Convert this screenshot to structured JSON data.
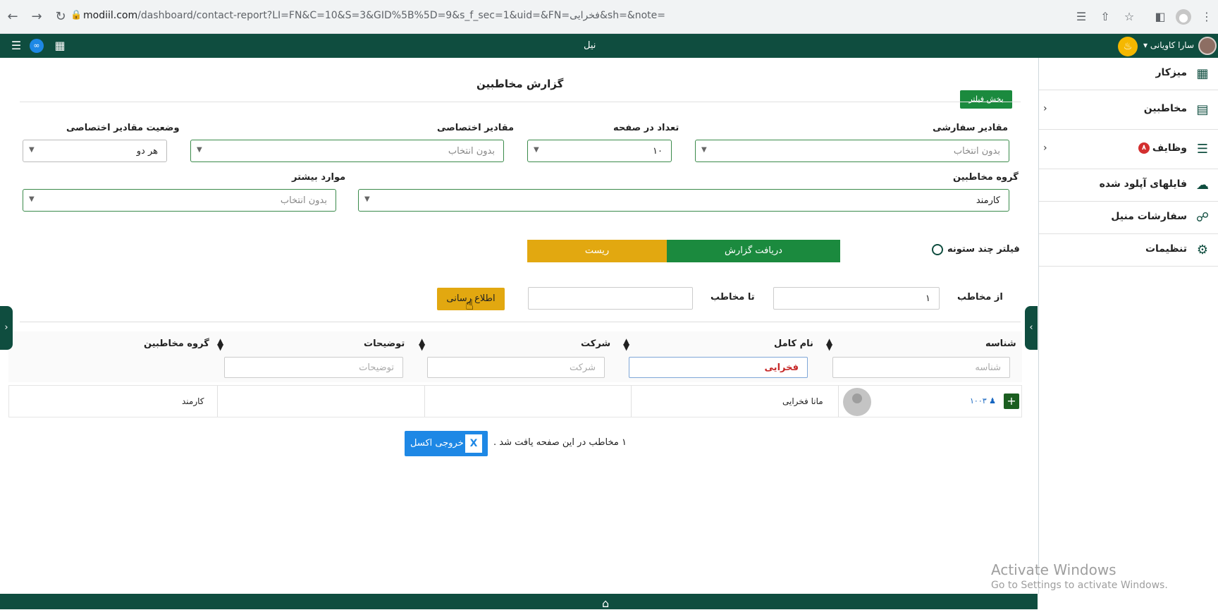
{
  "browser": {
    "url_domain": "modiil.com",
    "url_path": "/dashboard/contact-report?LI=FN&C=10&S=3&GID%5B%5D=9&s_f_sec=1&uid=&FN=فخرایی&sh=&note="
  },
  "appbar": {
    "center_text": "نیل",
    "user_name": "سارا کاویانی"
  },
  "sidebar": {
    "items": [
      {
        "label": "میزکار",
        "icon": "dashboard-icon"
      },
      {
        "label": "مخاطبین",
        "icon": "contacts-icon"
      },
      {
        "label": "وظایف",
        "badge": "۸",
        "icon": "tasks-icon"
      },
      {
        "label": "فایلهای آپلود شده",
        "icon": "cloud-upload-icon"
      },
      {
        "label": "سفارشات منیل",
        "icon": "cart-icon"
      },
      {
        "label": "تنظیمات",
        "icon": "gear-icon"
      }
    ]
  },
  "page": {
    "title": "گزارش مخاطبین",
    "filter_section_btn": "بخش فیلتر"
  },
  "filters": {
    "custom_values_label": "مقادیر سفارشی",
    "custom_values_value": "بدون انتخاب",
    "per_page_label": "تعداد در صفحه",
    "per_page_value": "۱۰",
    "special_values_label": "مقادیر اختصاصی",
    "special_values_value": "بدون انتخاب",
    "special_status_label": "وضعیت مقادیر اختصاصی",
    "special_status_value": "هر دو",
    "contact_group_label": "گروه مخاطبین",
    "contact_group_value": "کارمند",
    "more_label": "موارد بیشتر",
    "more_value": "بدون انتخاب",
    "multi_column_filter": "فیلتر چند ستونه",
    "report_btn": "دریافت گزارش",
    "reset_btn": "ریست",
    "from_contact_label": "از مخاطب",
    "from_contact_value": "۱",
    "to_contact_label": "تا مخاطب",
    "to_contact_value": "",
    "notify_btn": "اطلاع رسانی"
  },
  "table": {
    "columns": [
      {
        "label": "شناسه",
        "placeholder": "شناسه",
        "value": ""
      },
      {
        "label": "نام کامل",
        "placeholder": "نام کامل",
        "value": "فخرایی"
      },
      {
        "label": "شرکت",
        "placeholder": "شرکت",
        "value": ""
      },
      {
        "label": "توضیحات",
        "placeholder": "توضیحات",
        "value": ""
      },
      {
        "label": "گروه مخاطبین"
      }
    ],
    "rows": [
      {
        "id": "۱۰۰۳",
        "name": "مانا فخرایی",
        "company": "",
        "notes": "",
        "group": "کارمند"
      }
    ]
  },
  "footer": {
    "found_text": "۱ مخاطب در این صفحه یافت شد .",
    "excel_btn": "خروجی اکسل"
  },
  "os": {
    "activate_title": "Activate Windows",
    "activate_sub": "Go to Settings to activate Windows."
  }
}
